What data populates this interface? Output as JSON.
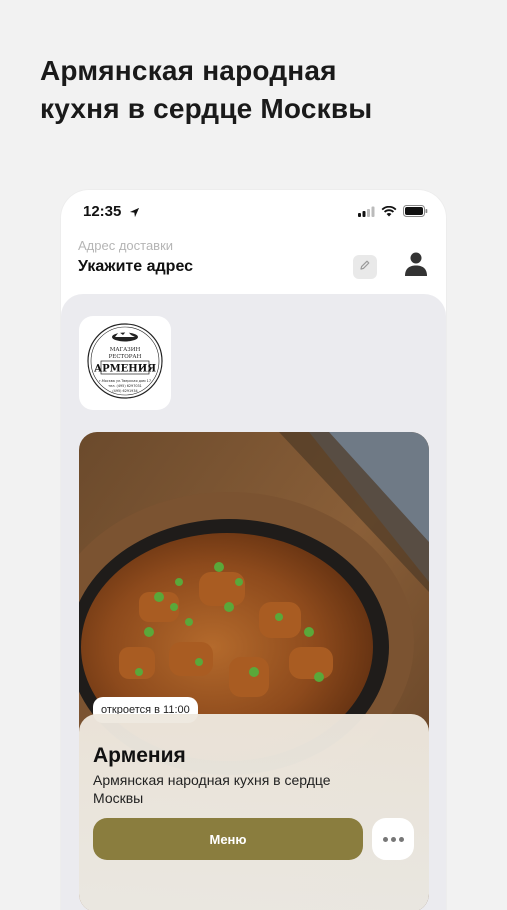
{
  "promo": {
    "headline_line1": "Армянская народная",
    "headline_line2": "кухня в сердце Москвы"
  },
  "status_bar": {
    "time": "12:35",
    "icons": [
      "location-arrow-icon",
      "signal-icon",
      "wifi-icon",
      "battery-icon"
    ]
  },
  "delivery": {
    "label": "Адрес доставки",
    "value": "Укажите адрес"
  },
  "restaurant": {
    "logo": {
      "line1": "МАГАЗИН",
      "line2": "РЕСТОРАН",
      "brand": "АРМЕНИЯ",
      "address": "г.Москва ул.Тверская дом 17",
      "phone1": "тел. (495) 6297031",
      "phone2": "(495) 6291934"
    },
    "status_badge": "откроется в 11:00",
    "name": "Армения",
    "description": "Армянская народная кухня в сердце Москвы",
    "menu_button": "Меню",
    "more_button_icon": "more-dots-icon"
  },
  "colors": {
    "accent": "#8a7d3e",
    "background": "#f2f2f2",
    "content_bg": "#ebebef"
  }
}
